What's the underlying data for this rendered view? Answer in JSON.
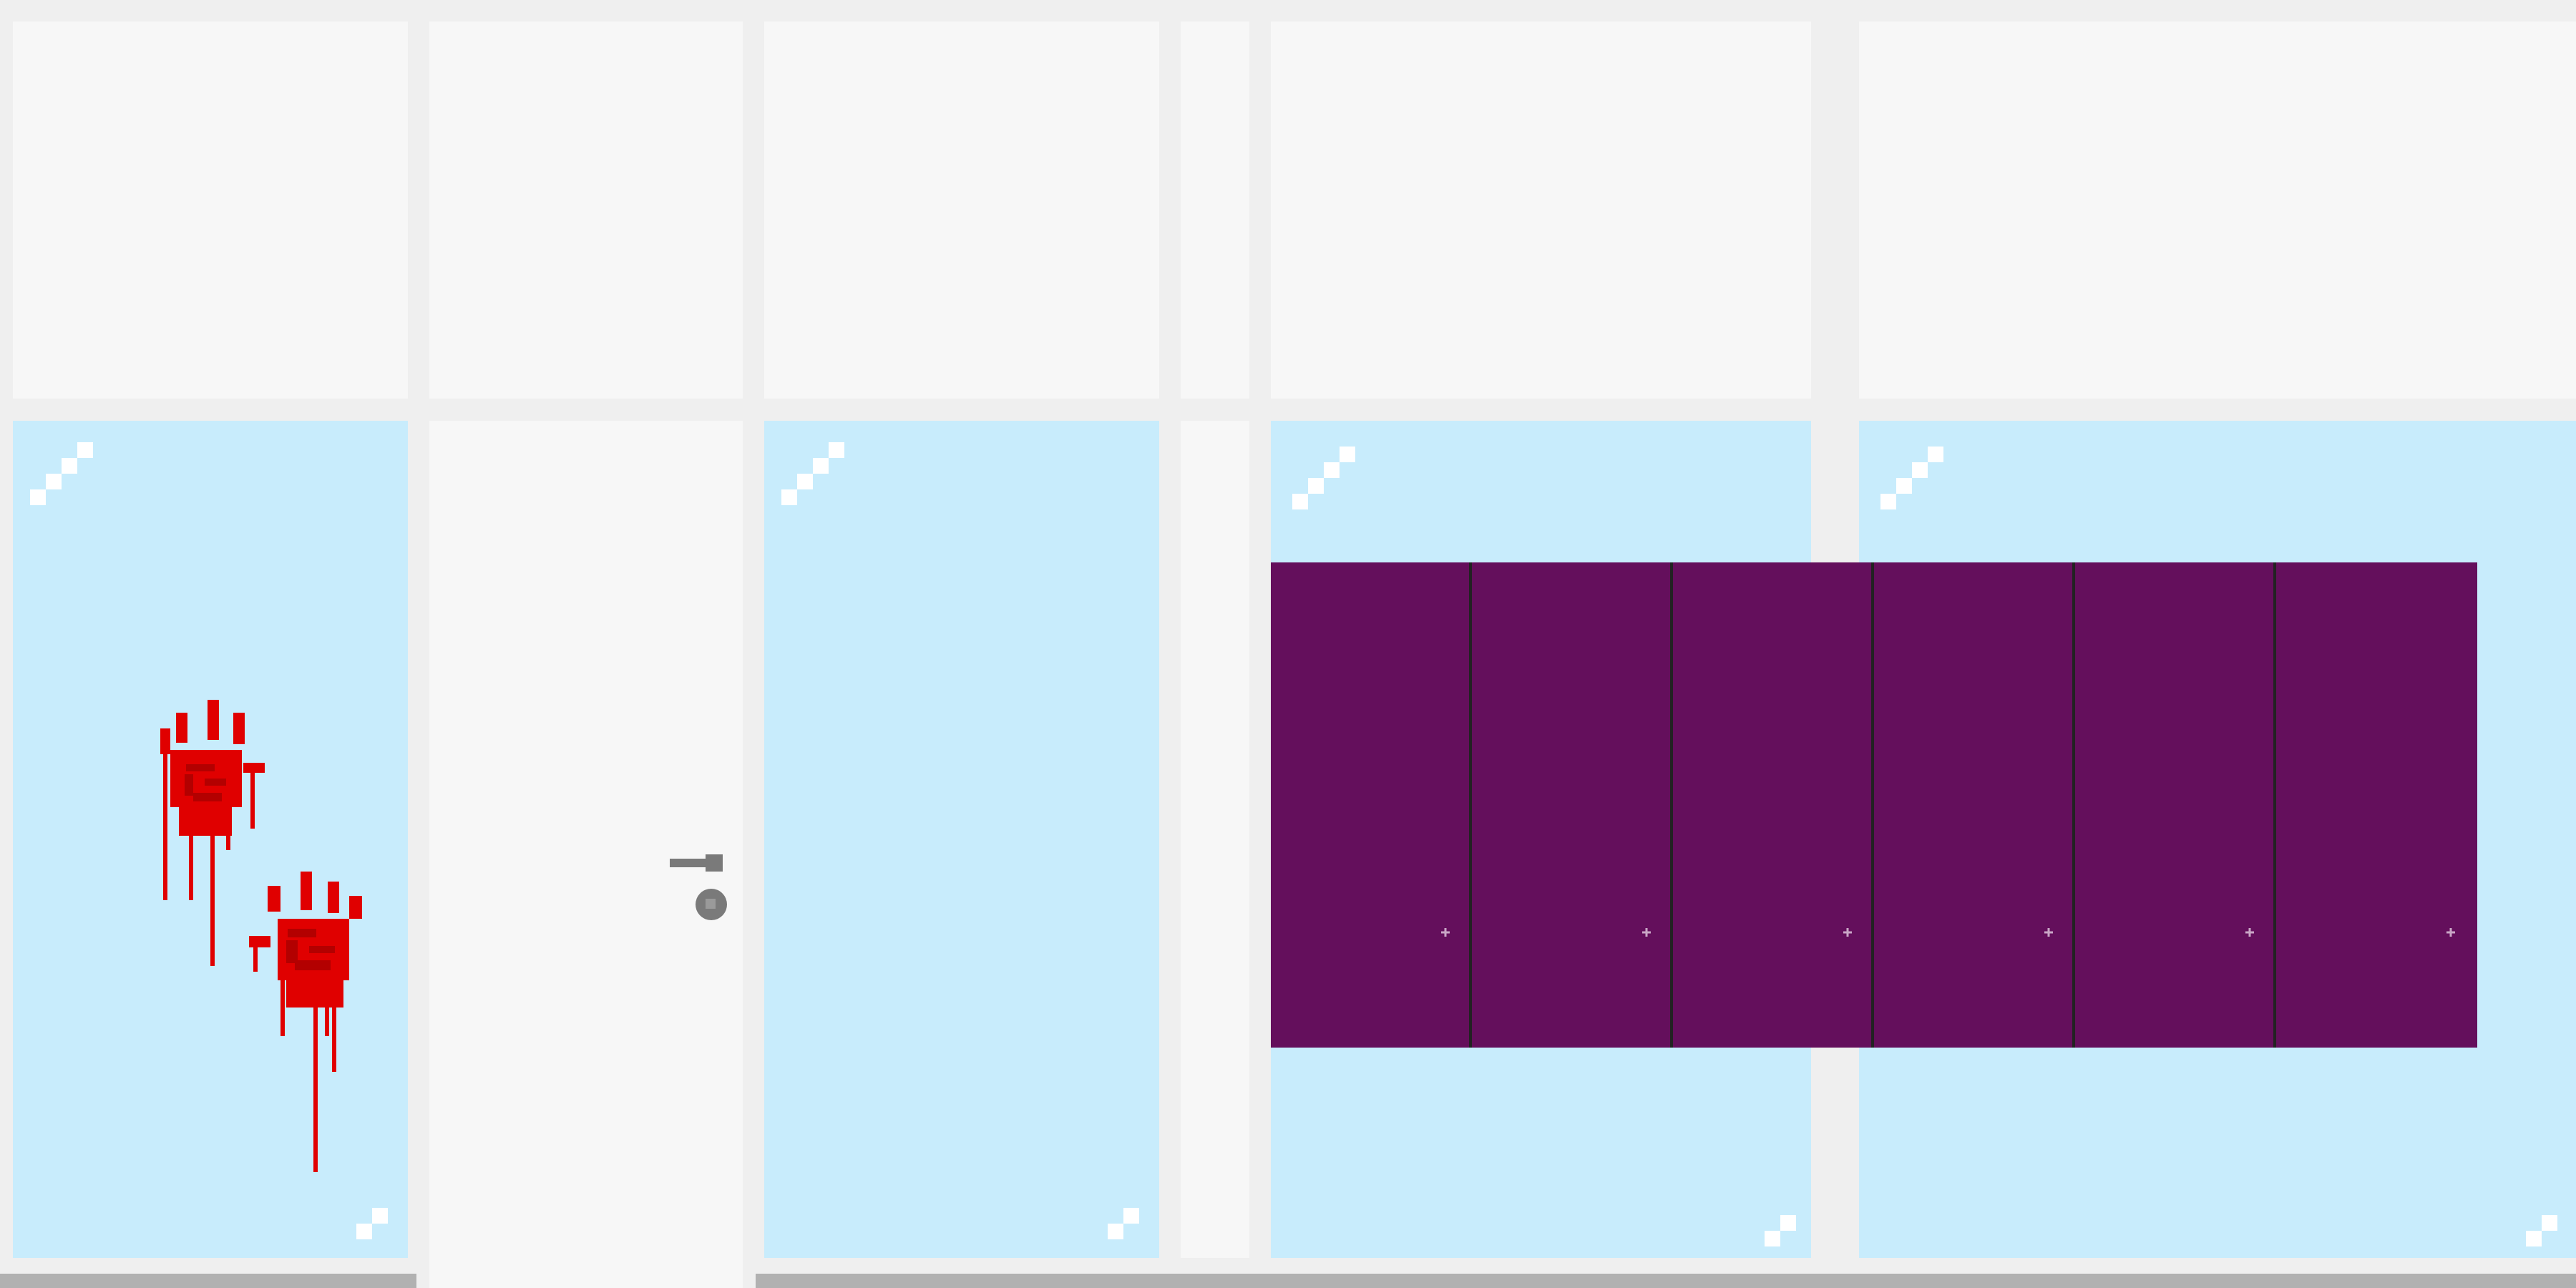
{
  "scene": {
    "name": "hallway",
    "background": "#efefef"
  },
  "colors": {
    "wall_panel": "#f7f7f7",
    "window_glass": "#c8ecfc",
    "locker_purple": "#640f5c",
    "locker_divider": "#222222",
    "blood": "#e00000",
    "blood_dark": "#b30000",
    "door_handle": "#7a7a7a",
    "floor_strip": "#b1b1b1",
    "glint": "#ffffff"
  },
  "icons": {
    "handprint": "bloody-handprint-icon",
    "door_handle": "door-handle-icon",
    "keyhole": "keyhole-icon",
    "glass_glint": "glass-glint-icon",
    "locker_lock": "locker-lock-icon"
  },
  "objects": {
    "locker_count": 6,
    "window_count": 4,
    "handprint_count": 2
  }
}
